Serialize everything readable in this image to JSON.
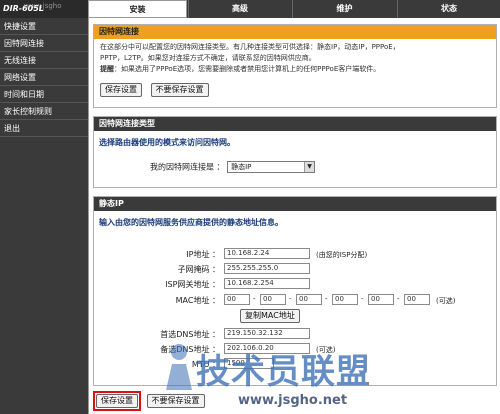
{
  "header": {
    "model": "DIR-605L",
    "watermark_tl": "www.jsgho",
    "tabs": [
      {
        "label": "安装",
        "active": true
      },
      {
        "label": "高级",
        "active": false
      },
      {
        "label": "维护",
        "active": false
      },
      {
        "label": "状态",
        "active": false
      }
    ]
  },
  "sidebar": {
    "items": [
      {
        "label": "快捷设置"
      },
      {
        "label": "因特网连接"
      },
      {
        "label": "无线连接"
      },
      {
        "label": "网络设置"
      },
      {
        "label": "时间和日期"
      },
      {
        "label": "家长控制规则"
      },
      {
        "label": "退出"
      }
    ]
  },
  "intro": {
    "title": "因特网连接",
    "line1": "在这部分中可以配置您的因特网连接类型。有几种连接类型可供选择：静态IP，动态IP，PPPoE，",
    "line2": "PPTP，L2TP。如果您对连接方式不确定，请联系您的因特网供应商。",
    "line3_bold": "提醒",
    "line3": "：如果选用了PPPoE选项，您需要删除或者禁用您计算机上的任何PPPoE客户端软件。",
    "save_label": "保存设置",
    "nosave_label": "不要保存设置"
  },
  "conn_type": {
    "title": "因特网连接类型",
    "subtitle": "选择路由器使用的模式来访问因特网。",
    "label": "我的因特网连接是 ：",
    "value": "静态IP"
  },
  "static_ip": {
    "title": "静态IP",
    "subtitle": "输入由您的因特网服务供应商提供的静态地址信息。",
    "ip_label": "IP地址 ：",
    "ip_value": "10.168.2.24",
    "ip_note": "(由您的ISP分配)",
    "mask_label": "子网掩码 ：",
    "mask_value": "255.255.255.0",
    "gw_label": "ISP网关地址 ：",
    "gw_value": "10.168.2.254",
    "mac_label": "MAC地址 ：",
    "mac_values": [
      "00",
      "00",
      "00",
      "00",
      "00",
      "00"
    ],
    "mac_note": "(可选)",
    "clone_label": "复制MAC地址",
    "dns1_label": "首选DNS地址 ：",
    "dns1_value": "219.150.32.132",
    "dns2_label": "备选DNS地址 ：",
    "dns2_value": "202.106.0.20",
    "dns2_note": "(可选)",
    "mtu_label": "MTU ：",
    "mtu_value": "1500"
  },
  "footer": {
    "save_label": "保存设置",
    "nosave_label": "不要保存设置"
  },
  "watermark": {
    "big": "技术员联盟",
    "url": "www.jsgho.net"
  },
  "colors": {
    "dark_bar": "#3a3a3a",
    "orange_header": "#f0a020",
    "highlight_red": "#dd1111",
    "subtitle_blue": "#1a3a7a"
  }
}
